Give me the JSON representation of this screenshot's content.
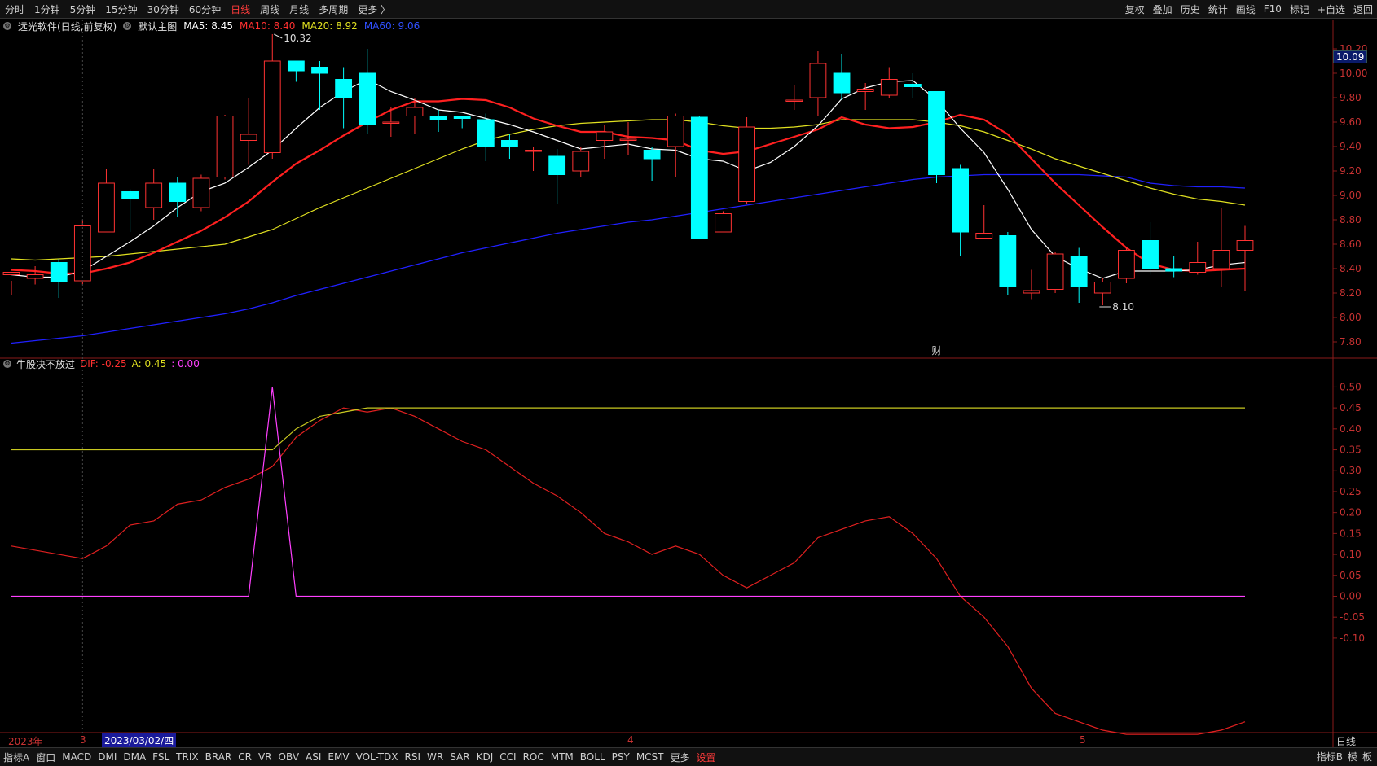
{
  "toolbar": {
    "periods": [
      "分时",
      "1分钟",
      "5分钟",
      "15分钟",
      "30分钟",
      "60分钟",
      "日线",
      "周线",
      "月线",
      "多周期",
      "更多 〉"
    ],
    "active_period": "日线",
    "right_tools": [
      "复权",
      "叠加",
      "历史",
      "统计",
      "画线",
      "F10",
      "标记",
      "+自选",
      "返回"
    ]
  },
  "main_info": {
    "stock": "远光软件(日线,前复权)",
    "template": "默认主图",
    "ma5": "MA5: 8.45",
    "ma10": "MA10: 8.40",
    "ma20": "MA20: 8.92",
    "ma60": "MA60: 9.06"
  },
  "indicator_info": {
    "name": "牛股决不放过",
    "dif": "DIF: -0.25",
    "a": "A: 0.45",
    "c": ": 0.00"
  },
  "price_tag": "10.09",
  "annotations": {
    "high": "10.32",
    "low": "8.10",
    "marker": "财"
  },
  "date_axis": {
    "year": "2023年",
    "cursor_date": "2023/03/02/四",
    "months": [
      "3",
      "4",
      "5"
    ],
    "right_label": "日线"
  },
  "bottom": {
    "tabs": [
      "指标A",
      "窗口",
      "MACD",
      "DMI",
      "DMA",
      "FSL",
      "TRIX",
      "BRAR",
      "CR",
      "VR",
      "OBV",
      "ASI",
      "EMV",
      "VOL-TDX",
      "RSI",
      "WR",
      "SAR",
      "KDJ",
      "CCI",
      "ROC",
      "MTM",
      "BOLL",
      "PSY",
      "MCST",
      "更多"
    ],
    "setting": "设置",
    "right": [
      "指标B",
      "模",
      "板"
    ]
  },
  "colors": {
    "up": "#ff3232",
    "down": "#00ffff",
    "ma5": "#ffffff",
    "ma10": "#ff2020",
    "ma20": "#e0e020",
    "ma60": "#2020ff",
    "dif": "#e02020",
    "a": "#c8c820",
    "c": "#ff40ff"
  },
  "chart_data": [
    {
      "type": "candlestick",
      "ylim": [
        7.7,
        10.3
      ],
      "y_ticks": [
        7.8,
        8.0,
        8.2,
        8.4,
        8.6,
        8.8,
        9.0,
        9.2,
        9.4,
        9.6,
        9.8,
        10.0,
        10.2
      ],
      "candles": [
        [
          8.35,
          8.37,
          8.3,
          8.18
        ],
        [
          8.32,
          8.35,
          8.42,
          8.27
        ],
        [
          8.45,
          8.29,
          8.48,
          8.16
        ],
        [
          8.3,
          8.75,
          8.8,
          8.27
        ],
        [
          8.7,
          9.1,
          9.22,
          8.7
        ],
        [
          9.03,
          8.97,
          9.05,
          8.7
        ],
        [
          8.9,
          9.1,
          9.22,
          8.8
        ],
        [
          9.1,
          8.95,
          9.15,
          8.82
        ],
        [
          8.9,
          9.14,
          9.17,
          8.87
        ],
        [
          9.15,
          9.65,
          9.66,
          9.13
        ],
        [
          9.45,
          9.5,
          9.8,
          9.25
        ],
        [
          9.35,
          10.1,
          10.32,
          9.3
        ],
        [
          10.1,
          10.02,
          10.1,
          9.93
        ],
        [
          10.05,
          10.0,
          10.1,
          9.7
        ],
        [
          9.95,
          9.8,
          10.05,
          9.55
        ],
        [
          10.0,
          9.58,
          10.2,
          9.5
        ],
        [
          9.6,
          9.6,
          9.72,
          9.48
        ],
        [
          9.65,
          9.72,
          9.8,
          9.5
        ],
        [
          9.65,
          9.62,
          9.7,
          9.52
        ],
        [
          9.65,
          9.63,
          9.65,
          9.55
        ],
        [
          9.62,
          9.4,
          9.67,
          9.28
        ],
        [
          9.45,
          9.4,
          9.5,
          9.3
        ],
        [
          9.37,
          9.37,
          9.4,
          9.2
        ],
        [
          9.32,
          9.17,
          9.38,
          8.93
        ],
        [
          9.2,
          9.36,
          9.4,
          9.15
        ],
        [
          9.45,
          9.52,
          9.58,
          9.3
        ],
        [
          9.46,
          9.46,
          9.6,
          9.33
        ],
        [
          9.37,
          9.3,
          9.4,
          9.12
        ],
        [
          9.4,
          9.65,
          9.67,
          9.15
        ],
        [
          9.64,
          8.65,
          9.65,
          8.7
        ],
        [
          8.7,
          8.85,
          8.87,
          8.75
        ],
        [
          8.95,
          9.56,
          9.64,
          8.93
        ],
        [
          null,
          null,
          null,
          null
        ],
        [
          9.78,
          9.78,
          9.9,
          9.7
        ],
        [
          9.8,
          10.08,
          10.18,
          9.65
        ],
        [
          10.0,
          9.84,
          10.16,
          9.78
        ],
        [
          9.85,
          9.87,
          9.92,
          9.7
        ],
        [
          9.82,
          9.95,
          10.05,
          9.8
        ],
        [
          9.91,
          9.89,
          10.0,
          9.8
        ],
        [
          9.85,
          9.17,
          9.85,
          9.1
        ],
        [
          9.22,
          8.7,
          9.25,
          8.5
        ],
        [
          8.65,
          8.69,
          8.92,
          8.65
        ],
        [
          8.67,
          8.25,
          8.7,
          8.18
        ],
        [
          8.2,
          8.22,
          8.39,
          8.15
        ],
        [
          8.23,
          8.52,
          8.54,
          8.2
        ],
        [
          8.5,
          8.25,
          8.57,
          8.12
        ],
        [
          8.2,
          8.29,
          8.32,
          8.1
        ],
        [
          8.32,
          8.55,
          8.58,
          8.28
        ],
        [
          8.63,
          8.4,
          8.78,
          8.35
        ],
        [
          8.4,
          8.38,
          8.5,
          8.33
        ],
        [
          8.37,
          8.45,
          8.62,
          8.35
        ],
        [
          8.4,
          8.55,
          8.9,
          8.25
        ],
        [
          8.55,
          8.63,
          8.75,
          8.22
        ]
      ],
      "ma5": [
        8.35,
        8.33,
        8.33,
        8.38,
        8.5,
        8.62,
        8.75,
        8.9,
        9.03,
        9.1,
        9.23,
        9.37,
        9.55,
        9.72,
        9.85,
        9.95,
        9.85,
        9.78,
        9.7,
        9.68,
        9.63,
        9.58,
        9.52,
        9.45,
        9.38,
        9.4,
        9.42,
        9.38,
        9.37,
        9.3,
        9.28,
        9.2,
        9.27,
        9.4,
        9.57,
        9.79,
        9.88,
        9.93,
        9.94,
        9.78,
        9.55,
        9.35,
        9.05,
        8.72,
        8.5,
        8.4,
        8.32,
        8.38,
        8.38,
        8.38,
        8.39,
        8.43,
        8.45
      ],
      "ma10": [
        8.39,
        8.38,
        8.36,
        8.36,
        8.4,
        8.45,
        8.53,
        8.62,
        8.71,
        8.82,
        8.95,
        9.11,
        9.26,
        9.37,
        9.49,
        9.6,
        9.7,
        9.77,
        9.77,
        9.79,
        9.78,
        9.72,
        9.63,
        9.57,
        9.52,
        9.52,
        9.48,
        9.47,
        9.45,
        9.37,
        9.34,
        9.36,
        9.42,
        9.48,
        9.54,
        9.64,
        9.58,
        9.55,
        9.56,
        9.6,
        9.66,
        9.62,
        9.5,
        9.3,
        9.1,
        8.92,
        8.74,
        8.57,
        8.44,
        8.39,
        8.38,
        8.39,
        8.4
      ],
      "ma20": [
        8.48,
        8.47,
        8.48,
        8.49,
        8.5,
        8.52,
        8.54,
        8.56,
        8.58,
        8.6,
        8.66,
        8.72,
        8.81,
        8.9,
        8.98,
        9.06,
        9.14,
        9.22,
        9.3,
        9.38,
        9.45,
        9.5,
        9.54,
        9.57,
        9.59,
        9.6,
        9.61,
        9.62,
        9.62,
        9.6,
        9.57,
        9.55,
        9.55,
        9.56,
        9.58,
        9.62,
        9.62,
        9.62,
        9.62,
        9.6,
        9.57,
        9.52,
        9.45,
        9.38,
        9.3,
        9.24,
        9.18,
        9.12,
        9.06,
        9.01,
        8.97,
        8.95,
        8.92
      ],
      "ma60": [
        7.79,
        7.81,
        7.83,
        7.85,
        7.88,
        7.91,
        7.94,
        7.97,
        8.0,
        8.03,
        8.07,
        8.12,
        8.18,
        8.23,
        8.28,
        8.33,
        8.38,
        8.43,
        8.48,
        8.53,
        8.57,
        8.61,
        8.65,
        8.69,
        8.72,
        8.75,
        8.78,
        8.8,
        8.83,
        8.86,
        8.89,
        8.92,
        8.95,
        8.98,
        9.01,
        9.04,
        9.07,
        9.1,
        9.13,
        9.15,
        9.16,
        9.17,
        9.17,
        9.17,
        9.17,
        9.17,
        9.16,
        9.15,
        9.1,
        9.08,
        9.07,
        9.07,
        9.06
      ]
    },
    {
      "type": "line",
      "ylim": [
        -0.32,
        0.53
      ],
      "y_ticks": [
        0.5,
        0.45,
        0.4,
        0.35,
        0.3,
        0.25,
        0.2,
        0.15,
        0.1,
        0.05,
        0.0,
        -0.05,
        -0.1
      ],
      "series": [
        {
          "name": "DIF",
          "values": [
            0.12,
            0.11,
            0.1,
            0.09,
            0.12,
            0.17,
            0.18,
            0.22,
            0.23,
            0.26,
            0.28,
            0.31,
            0.38,
            0.42,
            0.45,
            0.44,
            0.45,
            0.43,
            0.4,
            0.37,
            0.35,
            0.31,
            0.27,
            0.24,
            0.2,
            0.15,
            0.13,
            0.1,
            0.12,
            0.1,
            0.05,
            0.02,
            0.05,
            0.08,
            0.14,
            0.16,
            0.18,
            0.19,
            0.15,
            0.09,
            0.0,
            -0.05,
            -0.12,
            -0.22,
            -0.28,
            -0.3,
            -0.32,
            -0.33,
            -0.33,
            -0.33,
            -0.33,
            -0.32,
            -0.3
          ]
        },
        {
          "name": "A",
          "values": [
            0.35,
            0.35,
            0.35,
            0.35,
            0.35,
            0.35,
            0.35,
            0.35,
            0.35,
            0.35,
            0.35,
            0.35,
            0.4,
            0.43,
            0.44,
            0.45,
            0.45,
            0.45,
            0.45,
            0.45,
            0.45,
            0.45,
            0.45,
            0.45,
            0.45,
            0.45,
            0.45,
            0.45,
            0.45,
            0.45,
            0.45,
            0.45,
            0.45,
            0.45,
            0.45,
            0.45,
            0.45,
            0.45,
            0.45,
            0.45,
            0.45,
            0.45,
            0.45,
            0.45,
            0.45,
            0.45,
            0.45,
            0.45,
            0.45,
            0.45,
            0.45,
            0.45,
            0.45
          ]
        },
        {
          "name": "C",
          "values": [
            0,
            0,
            0,
            0,
            0,
            0,
            0,
            0,
            0,
            0,
            0,
            0.5,
            0,
            0,
            0,
            0,
            0,
            0,
            0,
            0,
            0,
            0,
            0,
            0,
            0,
            0,
            0,
            0,
            0,
            0,
            0,
            0,
            0,
            0,
            0,
            0,
            0,
            0,
            0,
            0,
            0,
            0,
            0,
            0,
            0,
            0,
            0,
            0,
            0,
            0,
            0,
            0,
            0
          ]
        }
      ]
    }
  ]
}
